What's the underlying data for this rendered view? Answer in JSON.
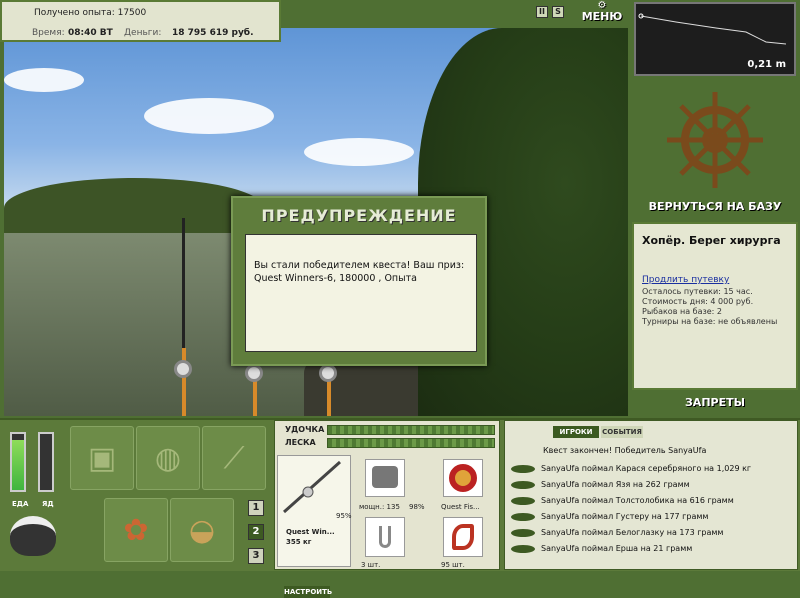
{
  "stats": {
    "exp_label": "Получено опыта: 17500",
    "time_label": "Время:",
    "time_value": "08:40 ВТ",
    "money_label": "Деньги:",
    "money_value": "18 795 619 руб."
  },
  "top": {
    "pause": "II",
    "sound": "S",
    "menu": "МЕНЮ"
  },
  "depth": {
    "value": "0,21 m"
  },
  "nav": {
    "return_base": "ВЕРНУТЬСЯ НА БАЗУ",
    "bans": "ЗАПРЕТЫ"
  },
  "location": {
    "name": "Хопёр. Берег хирурга",
    "extend_link": "Продлить путевку",
    "lines": [
      "Осталось путевки: 15 час.",
      "Стоимость дня: 4 000 руб.",
      "Рыбаков на базе: 2",
      "Турниры на базе: не объявлены"
    ]
  },
  "dialog": {
    "title": "ПРЕДУПРЕЖДЕНИЕ",
    "text": "Вы стали победителем квеста! Ваш приз: Quest Winners-6, 180000 , Опыта"
  },
  "meters": {
    "food_label": "ЕДА",
    "poison_label": "ЯД",
    "food_level": 0.9,
    "poison_level": 0
  },
  "pages": [
    "1",
    "2",
    "3"
  ],
  "tackle": {
    "rod_label": "УДОЧКА",
    "line_label": "ЛЕСКА",
    "rod_name": "Quest Win...",
    "rod_weight": "355 кг",
    "rod_percent": "95%",
    "reel_power": "мощн.: 135",
    "reel_percent": "98%",
    "line_name": "Quest Fis...",
    "hook_count": "3 шт.",
    "bait_count": "95 шт.",
    "setup_button": "НАСТРОИТЬ"
  },
  "log": {
    "tab_players": "ИГРОКИ",
    "tab_events": "СОБЫТИЯ",
    "header": "Квест закончен! Победитель SanyaUfa",
    "entries": [
      "SanyaUfa поймал Карася серебряного на 1,029 кг",
      "SanyaUfa поймал Язя на 262 грамм",
      "SanyaUfa поймал Толстолобика на 616 грамм",
      "SanyaUfa поймал Густеру на 177 грамм",
      "SanyaUfa поймал Белоглазку на 173 грамм",
      "SanyaUfa поймал Ерша на 21 грамм"
    ]
  },
  "colors": {
    "panel_green": "#5c7a3a",
    "accent_dark": "#3b5a20",
    "panel_light": "#e4e6d3"
  }
}
